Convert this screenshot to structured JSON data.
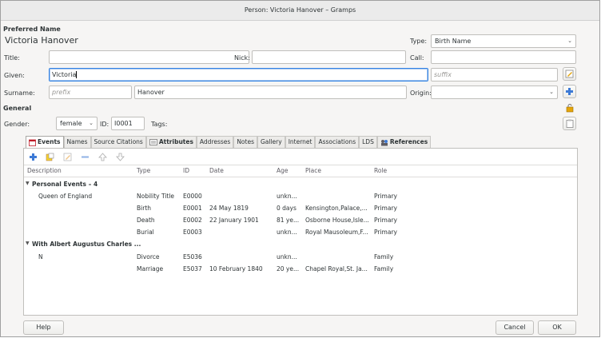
{
  "window": {
    "title": "Person: Victoria Hanover – Gramps"
  },
  "preferred_name": {
    "section_title": "Preferred Name",
    "display_name": "Victoria Hanover",
    "type_label": "Type:",
    "type_value": "Birth Name",
    "title_label": "Title:",
    "title_value": "",
    "nick_label": "Nick:",
    "nick_value": "",
    "call_label": "Call:",
    "call_value": "",
    "given_label": "Given:",
    "given_value": "Victoria",
    "suffix_placeholder": "suffix",
    "surname_label": "Surname:",
    "prefix_placeholder": "prefix",
    "surname_value": "Hanover",
    "origin_label": "Origin:",
    "origin_value": ""
  },
  "general": {
    "section_title": "General",
    "gender_label": "Gender:",
    "gender_value": "female",
    "id_label": "ID:",
    "id_value": "I0001",
    "tags_label": "Tags:"
  },
  "tabs": [
    {
      "label": "Events",
      "active": true,
      "bold": true,
      "icon": "events-icon"
    },
    {
      "label": "Names"
    },
    {
      "label": "Source Citations"
    },
    {
      "label": "Attributes",
      "bold": true,
      "icon": "attributes-icon"
    },
    {
      "label": "Addresses"
    },
    {
      "label": "Notes"
    },
    {
      "label": "Gallery"
    },
    {
      "label": "Internet"
    },
    {
      "label": "Associations"
    },
    {
      "label": "LDS"
    },
    {
      "label": "References",
      "bold": true,
      "icon": "references-icon"
    }
  ],
  "events_table": {
    "columns": [
      "Description",
      "Type",
      "ID",
      "Date",
      "Age",
      "Place",
      "Role"
    ],
    "rows": [
      {
        "group": true,
        "description": "Personal Events – 4"
      },
      {
        "description": "Queen of England",
        "type": "Nobility Title",
        "id": "E0000",
        "date": "",
        "age": "unkn...",
        "place": "",
        "role": "Primary"
      },
      {
        "description": "",
        "type": "Birth",
        "id": "E0001",
        "date": "24 May 1819",
        "age": "0 days",
        "place": "Kensington,Palace,...",
        "role": "Primary"
      },
      {
        "description": "",
        "type": "Death",
        "id": "E0002",
        "date": "22 January 1901",
        "age": "81 ye...",
        "place": "Osborne House,Isle...",
        "role": "Primary"
      },
      {
        "description": "",
        "type": "Burial",
        "id": "E0003",
        "date": "",
        "age": "unkn...",
        "place": "Royal Mausoleum,F...",
        "role": "Primary"
      },
      {
        "group": true,
        "description": "With Albert Augustus Charles ..."
      },
      {
        "description": "N",
        "type": "Divorce",
        "id": "E5036",
        "date": "",
        "age": "unkn...",
        "place": "",
        "role": "Family"
      },
      {
        "description": "",
        "type": "Marriage",
        "id": "E5037",
        "date": "10 February 1840",
        "age": "20 ye...",
        "place": "Chapel Royal,St. Ja...",
        "role": "Family"
      }
    ]
  },
  "buttons": {
    "help": "Help",
    "cancel": "Cancel",
    "ok": "OK"
  },
  "colors": {
    "accent": "#3584e4",
    "add_icon": "#3d7ad6",
    "remove_icon": "#3d7ad6"
  }
}
